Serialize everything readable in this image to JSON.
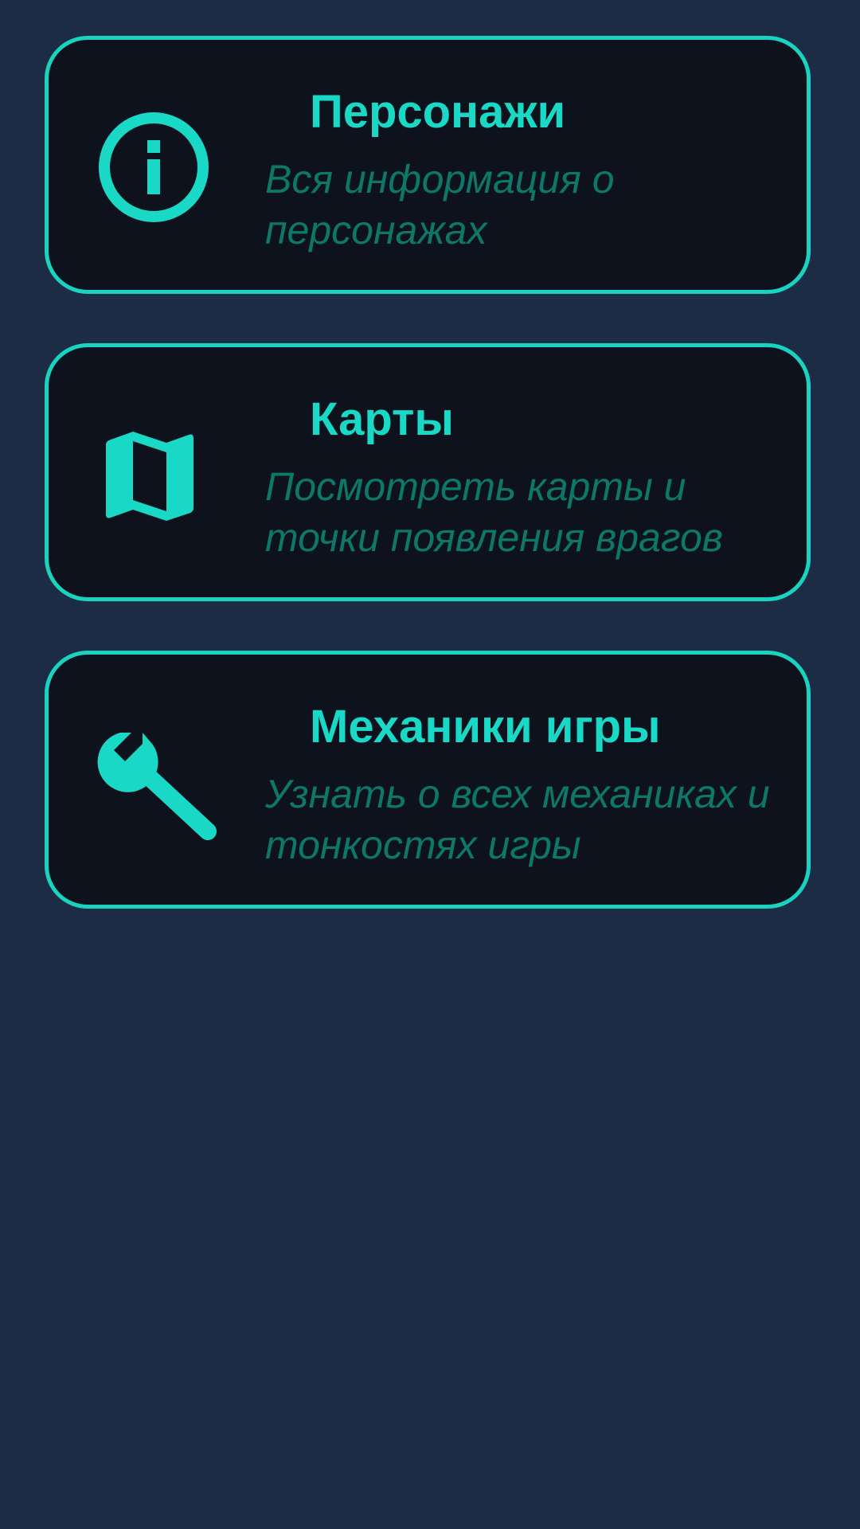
{
  "theme": {
    "background": "#1c2c44",
    "card_background": "#0d121d",
    "accent": "#19d2c0",
    "subtitle_color": "#0e7868"
  },
  "menu": {
    "items": [
      {
        "icon": "info-circle-icon",
        "title": "Персонажи",
        "subtitle": "Вся информация о персонажах"
      },
      {
        "icon": "map-icon",
        "title": "Карты",
        "subtitle": "Посмотреть карты и точки появления врагов"
      },
      {
        "icon": "wrench-icon",
        "title": "Механики игры",
        "subtitle": "Узнать о всех механиках и тонкостях игры"
      }
    ]
  }
}
